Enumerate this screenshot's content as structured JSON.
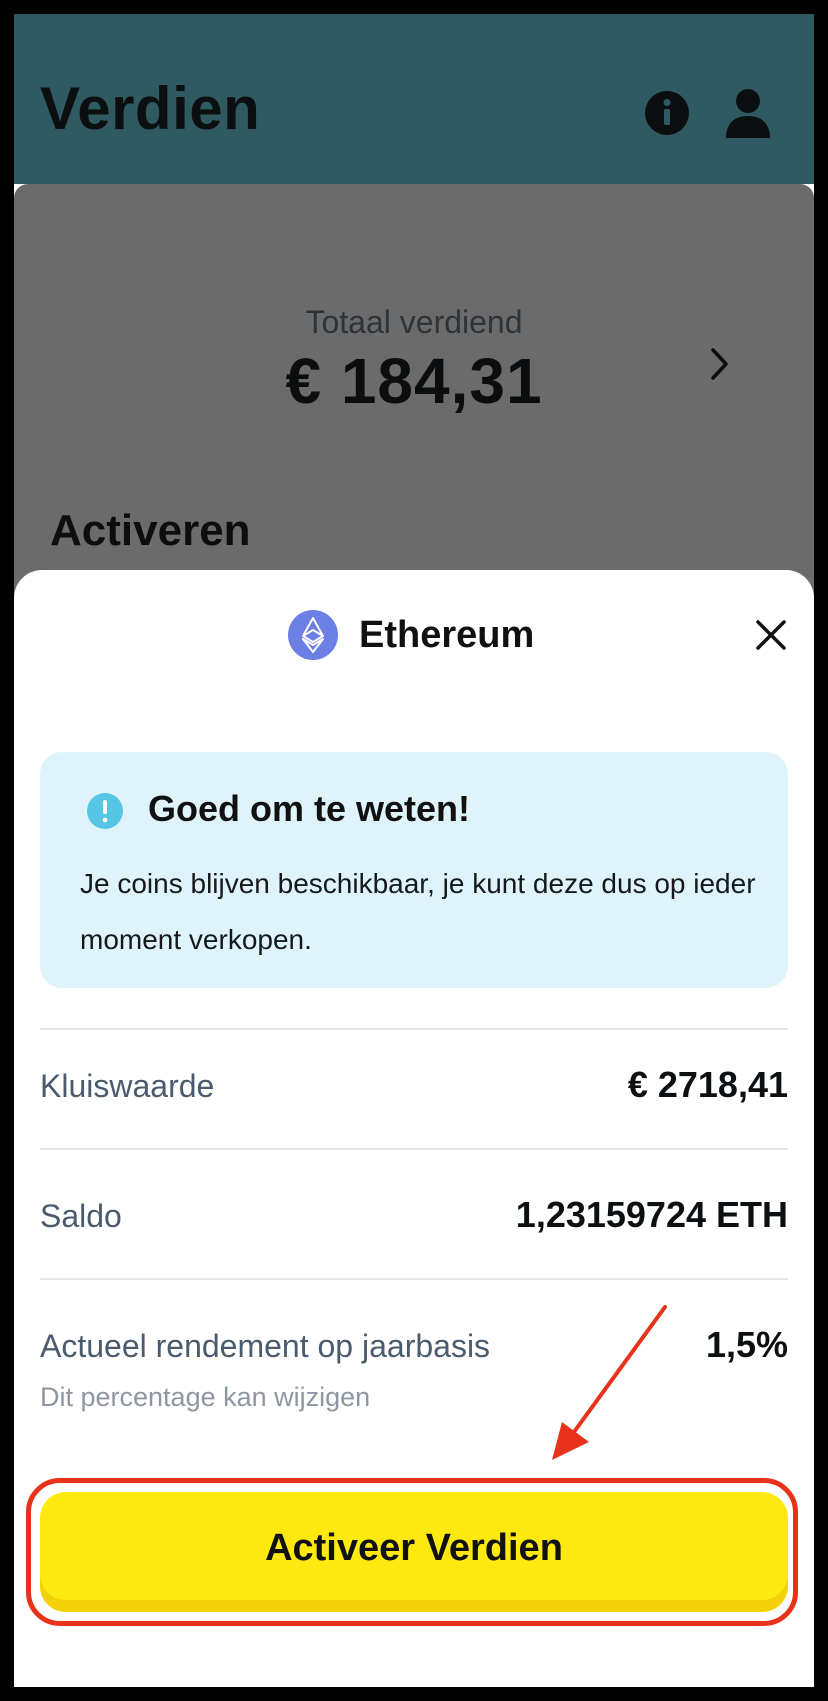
{
  "header": {
    "title": "Verdien",
    "info_icon": "info-icon",
    "user_icon": "user-icon"
  },
  "summary": {
    "total_label": "Totaal verdiend",
    "total_value": "€ 184,31",
    "chevron_icon": "chevron-right-icon"
  },
  "section": {
    "title": "Activeren"
  },
  "sheet": {
    "title": "Ethereum",
    "coin_icon": "ethereum-icon",
    "close_icon": "close-icon",
    "notice": {
      "icon": "exclamation-icon",
      "title": "Goed om te weten!",
      "text": "Je coins blijven beschikbaar, je kunt deze dus op ieder moment verkopen."
    },
    "rows": [
      {
        "label": "Kluiswaarde",
        "value": "€ 2718,41"
      },
      {
        "label": "Saldo",
        "value": "1,23159724 ETH"
      },
      {
        "label": "Actueel rendement op jaarbasis",
        "value": "1,5%",
        "sub": "Dit percentage kan wijzigen"
      }
    ],
    "cta_label": "Activeer Verdien"
  },
  "colors": {
    "header_bg": "#2f5a62",
    "overlay_bg": "#6b6b6b",
    "notice_bg": "#dff4fa",
    "notice_icon": "#55c6e4",
    "eth_icon": "#6c7fe4",
    "cta_bg": "#fde90f",
    "highlight": "#e8321c"
  }
}
